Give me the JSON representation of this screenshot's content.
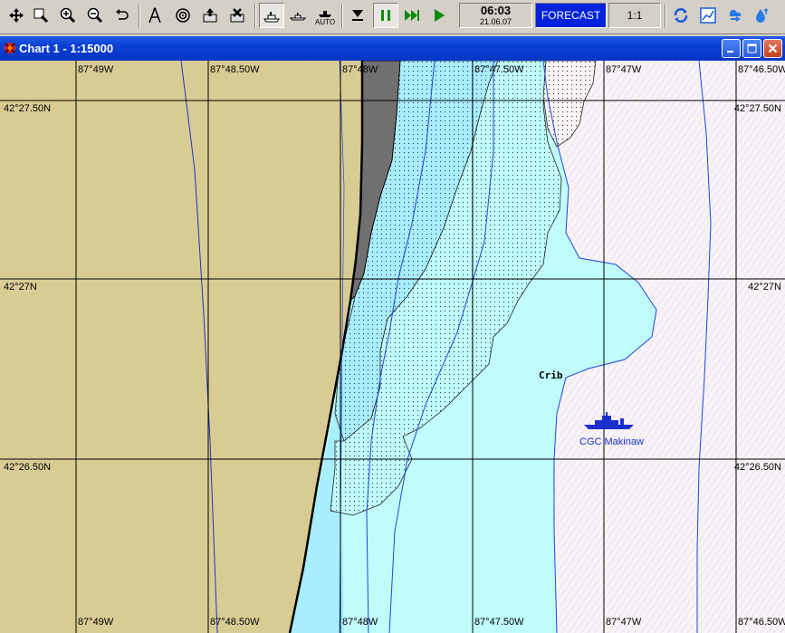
{
  "toolbar": {
    "buttons": [
      {
        "name": "move-icon"
      },
      {
        "name": "zoom-rect-icon"
      },
      {
        "name": "zoom-in-icon"
      },
      {
        "name": "zoom-out-icon"
      },
      {
        "name": "undo-icon"
      },
      {
        "name": "compass-dividers-icon"
      },
      {
        "name": "target-icon"
      },
      {
        "name": "export-icon"
      },
      {
        "name": "clear-icon"
      },
      {
        "name": "own-ship-icon"
      },
      {
        "name": "ship-center-icon"
      },
      {
        "name": "auto-ship-icon"
      },
      {
        "name": "drop-icon"
      },
      {
        "name": "pause-icon"
      },
      {
        "name": "fast-forward-icon"
      },
      {
        "name": "play-icon"
      },
      {
        "name": "rotate-icon"
      },
      {
        "name": "chart-graph-icon"
      },
      {
        "name": "weather-icon"
      },
      {
        "name": "tide-icon"
      }
    ],
    "auto_label": "AUTO",
    "clock_time": "06:03",
    "clock_date": "21.06.07",
    "forecast_label": "FORECAST",
    "scale_value": "1:1"
  },
  "window": {
    "title": "Chart 1 - 1:15000"
  },
  "chart": {
    "top_lon_labels": [
      "87°49W",
      "87°48.50W",
      "87°48W",
      "87°47.50W",
      "87°47W",
      "87°46.50W"
    ],
    "bottom_lon_labels": [
      "87°49W",
      "87°48.50W",
      "87°48W",
      "87°47.50W",
      "87°47W",
      "87°46.50W"
    ],
    "left_lat_labels": [
      "42°27.50N",
      "42°27N",
      "42°26.50N"
    ],
    "right_lat_labels": [
      "42°27.50N",
      "42°27N",
      "42°26.50N"
    ],
    "feature_label": "Crib",
    "vessel_name": "CGC Makinaw",
    "colors": {
      "land": "#d8cc94",
      "shallow": "#a8eeff",
      "medium": "#c0fcfc",
      "deep": "#f7f3f7",
      "grid": "#000000",
      "contour": "#2244dd",
      "vessel": "#1a2fcc"
    }
  }
}
